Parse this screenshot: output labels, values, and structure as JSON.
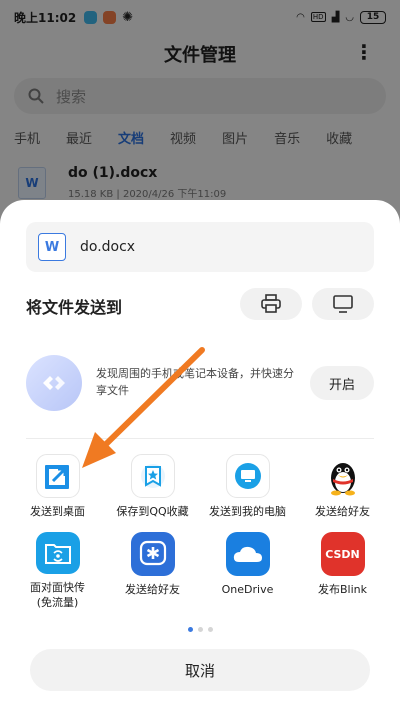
{
  "status_bar": {
    "time": "晚上11:02",
    "battery": "15"
  },
  "app": {
    "title": "文件管理",
    "search_placeholder": "搜索",
    "tabs": [
      "手机",
      "最近",
      "文档",
      "视频",
      "图片",
      "音乐",
      "收藏"
    ],
    "active_tab": "文档",
    "file": {
      "name": "do (1).docx",
      "meta": "15.18 KB | 2020/4/26 下午11:09"
    }
  },
  "sheet": {
    "file_name": "do.docx",
    "send_to_title": "将文件发送到",
    "nearby_text": "发现周围的手机或笔记本设备，并快速分享文件",
    "open_label": "开启",
    "apps_row1": [
      {
        "label": "发送到桌面",
        "icon": "send-to-desktop-icon",
        "color": "#ffffff"
      },
      {
        "label": "保存到QQ收藏",
        "icon": "qq-favorites-icon",
        "color": "#ffffff"
      },
      {
        "label": "发送到我的电脑",
        "icon": "my-computer-icon",
        "color": "#ffffff"
      },
      {
        "label": "发送给好友",
        "icon": "qq-penguin-icon",
        "color": "#ffffff"
      }
    ],
    "apps_row2": [
      {
        "label": "面对面快传\n(免流量)",
        "icon": "face-to-face-transfer-icon",
        "color": "#1aa0e6"
      },
      {
        "label": "发送给好友",
        "icon": "tim-icon",
        "color": "#2d6fd8"
      },
      {
        "label": "OneDrive",
        "icon": "onedrive-icon",
        "color": "#1a7fe0"
      },
      {
        "label": "发布Blink",
        "icon": "csdn-icon",
        "color": "#e0332b"
      }
    ],
    "csdn_text": "CSDN",
    "cancel_label": "取消"
  },
  "colors": {
    "accent": "#3b7ae0",
    "arrow": "#f07a22"
  }
}
